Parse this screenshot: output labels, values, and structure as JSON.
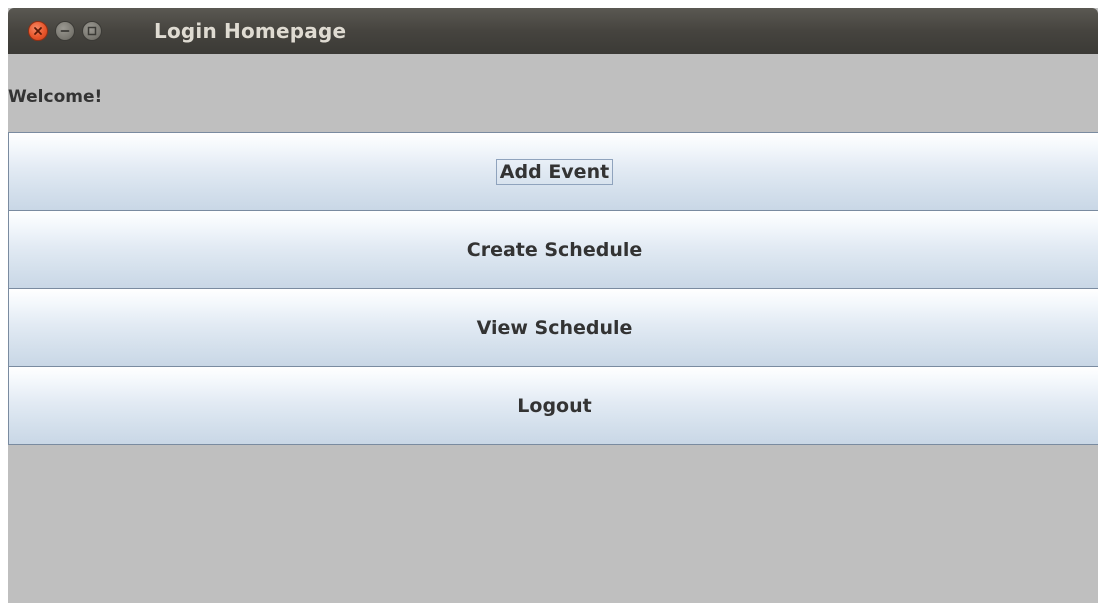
{
  "window": {
    "title": "Login Homepage",
    "controls": {
      "close": "close-icon",
      "minimize": "minimize-icon",
      "maximize": "maximize-icon"
    }
  },
  "main": {
    "welcome_text": "Welcome!",
    "buttons": [
      {
        "label": "Add Event",
        "focused": true
      },
      {
        "label": "Create Schedule",
        "focused": false
      },
      {
        "label": "View Schedule",
        "focused": false
      },
      {
        "label": "Logout",
        "focused": false
      }
    ]
  },
  "colors": {
    "close_button": "#e9562b",
    "titlebar": "#46443f",
    "content_background": "#bfbfbf",
    "button_border": "#7a8ba0"
  }
}
